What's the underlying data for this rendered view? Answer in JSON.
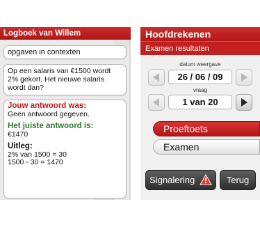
{
  "left_panel": {
    "title": "Logboek van Willem",
    "topic": "opgaven in contexten",
    "question": "Op een salaris van €1500 wordt 2% gekort. Het nieuwe salaris wordt dan?",
    "your_answer_heading": "Jouw antwoord was:",
    "your_answer": "Geen antwoord gegeven.",
    "correct_heading": "Het juiste antwoord is:",
    "correct_answer": "€1470",
    "explanation_heading": "Uitleg:",
    "explanation_lines": [
      "2% van 1500 = 30",
      "1500 - 30 = 1470"
    ]
  },
  "right_panel": {
    "title": "Hoofdrekenen",
    "subtitle": "Examen resultaten",
    "date_stepper": {
      "label": "datum weergave",
      "value": "26 / 06 / 09"
    },
    "question_stepper": {
      "label": "vraag",
      "value": "1 van 20"
    },
    "tabs": [
      {
        "label": "Proeftoets",
        "active": true
      },
      {
        "label": "Examen",
        "active": false
      }
    ],
    "buttons": {
      "signal": "Signalering",
      "back": "Terug"
    },
    "icons": {
      "prev": "arrow-left-icon",
      "next": "arrow-right-icon",
      "warning": "warning-icon"
    }
  },
  "colors": {
    "brand_red": "#c42020",
    "correct_green": "#2c7a2c",
    "dark_button": "#3a3a3a"
  }
}
